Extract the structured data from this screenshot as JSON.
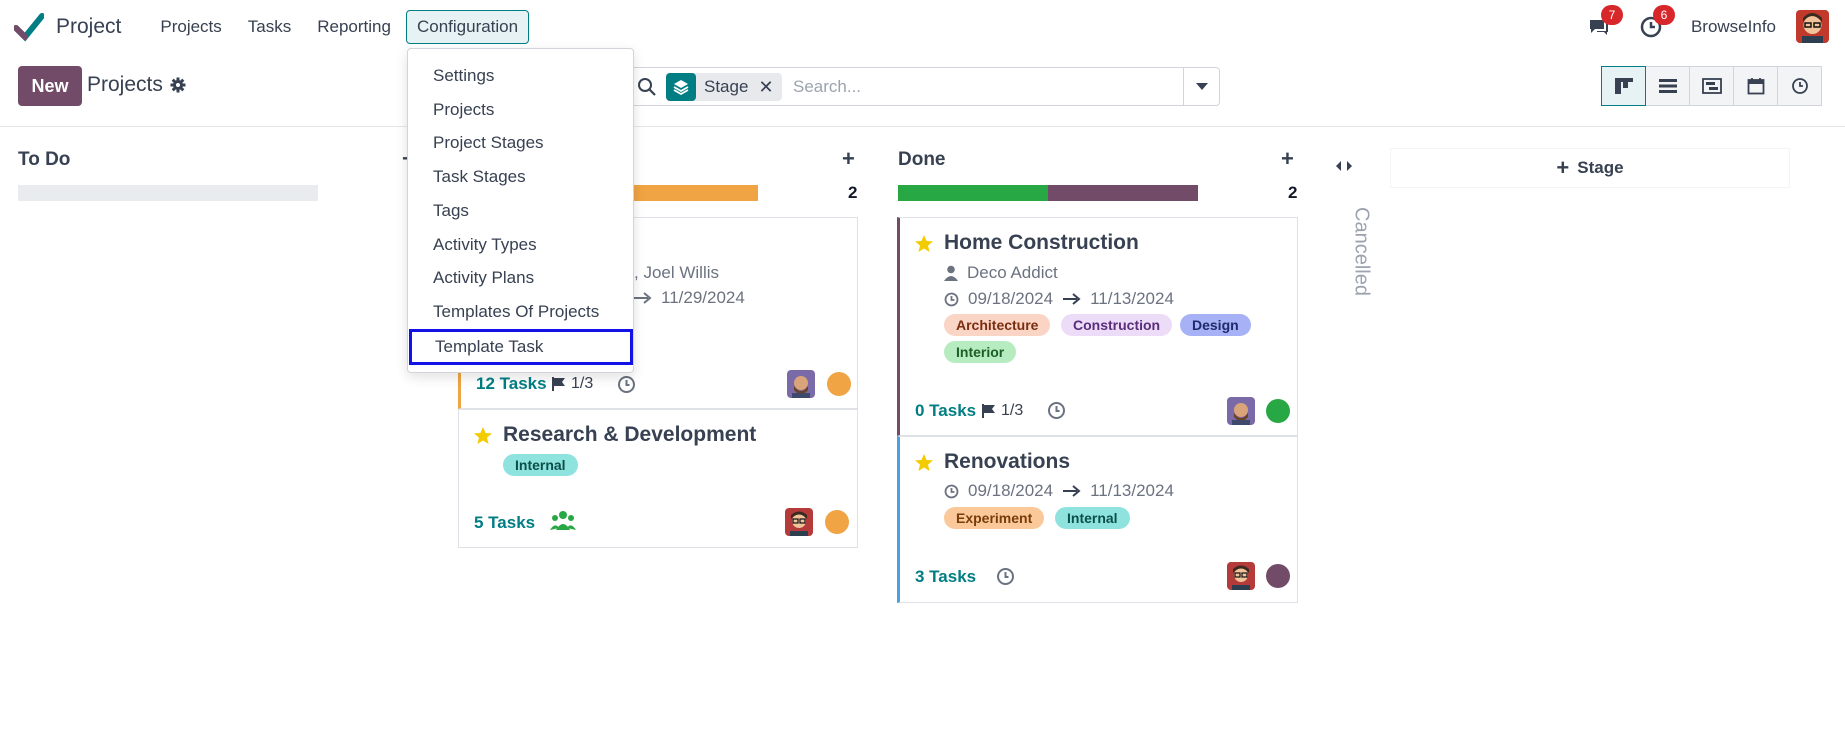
{
  "navbar": {
    "app_name": "Project",
    "menu": [
      "Projects",
      "Tasks",
      "Reporting",
      "Configuration"
    ],
    "messages_count": "7",
    "activities_count": "6",
    "company": "BrowseInfo"
  },
  "control": {
    "new_label": "New",
    "title": "Projects",
    "facet_label": "Stage",
    "search_placeholder": "Search..."
  },
  "dropdown": {
    "items": [
      "Settings",
      "Projects",
      "Project Stages",
      "Task Stages",
      "Tags",
      "Activity Types",
      "Activity Plans",
      "Templates Of Projects",
      "Template Task"
    ]
  },
  "kanban": {
    "todo": {
      "title": "To Do"
    },
    "middle": {
      "count": "2",
      "card1": {
        "members": ", Joel Willis",
        "date_end": "11/29/2024",
        "tasks": "12 Tasks",
        "milestones": "1/3",
        "status_color": "#f0a443"
      },
      "card2": {
        "title": "Research & Development",
        "tag": "Internal",
        "tasks": "5 Tasks",
        "status_color": "#f0a443"
      }
    },
    "done": {
      "title": "Done",
      "count": "2",
      "card1": {
        "title": "Home Construction",
        "customer": "Deco Addict",
        "date_start": "09/18/2024",
        "date_end": "11/13/2024",
        "tags": [
          "Architecture",
          "Construction",
          "Design",
          "Interior"
        ],
        "tasks": "0 Tasks",
        "milestones": "1/3",
        "status_color": "#28a745"
      },
      "card2": {
        "title": "Renovations",
        "date_start": "09/18/2024",
        "date_end": "11/13/2024",
        "tags": [
          "Experiment",
          "Internal"
        ],
        "tasks": "3 Tasks",
        "status_color": "#714b67"
      }
    },
    "cancelled": "Cancelled",
    "add_stage": "Stage"
  },
  "colors": {
    "accent": "#714b67",
    "teal": "#017e84",
    "done_green": "#28a745",
    "progress_orange": "#f0a443"
  }
}
